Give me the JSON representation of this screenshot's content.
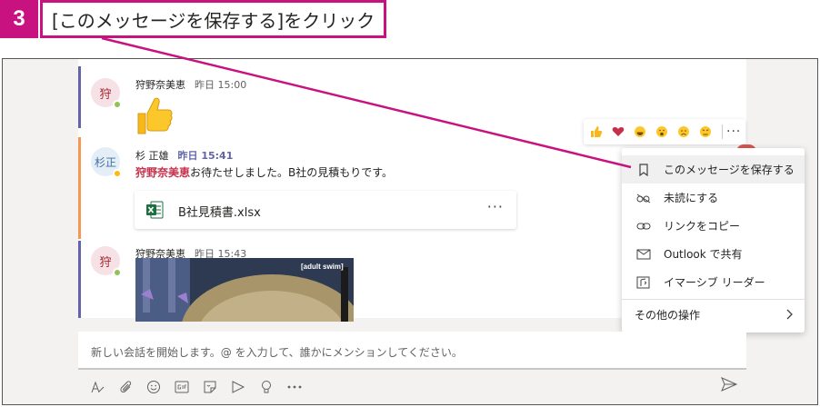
{
  "step": {
    "number": "3",
    "instruction": "[このメッセージを保存する]をクリック"
  },
  "messages": [
    {
      "avatar": "狩",
      "sender": "狩野奈美恵",
      "time": "昨日 15:00",
      "content_icon": "thumbs-up-emoji"
    },
    {
      "avatar": "杉正",
      "sender": "杉 正雄",
      "time": "昨日 15:41",
      "mention": "狩野奈美恵",
      "text": "お待たせしました。B社の見積もりです。",
      "attachment": {
        "filename": "B社見積書.xlsx",
        "file_icon": "excel-icon",
        "more": "···"
      }
    },
    {
      "avatar": "狩",
      "sender": "狩野奈美恵",
      "time": "昨日 15:43",
      "gif_caption": "[adult swim]"
    }
  ],
  "reactions": [
    "like",
    "heart",
    "laugh",
    "surprised",
    "sad",
    "angry"
  ],
  "reactions_more": "···",
  "context_menu": [
    {
      "label": "このメッセージを保存する",
      "icon": "bookmark-icon"
    },
    {
      "label": "未読にする",
      "icon": "unread-icon"
    },
    {
      "label": "リンクをコピー",
      "icon": "link-icon"
    },
    {
      "label": "Outlook で共有",
      "icon": "mail-icon"
    },
    {
      "label": "イマーシブ リーダー",
      "icon": "immersive-reader-icon"
    },
    {
      "label": "その他の操作",
      "icon": "chevron-right-icon"
    }
  ],
  "compose": {
    "placeholder": "新しい会話を開始します。@ を入力して、誰かにメンションしてください。"
  },
  "toolbar": [
    "format-icon",
    "attach-icon",
    "emoji-icon",
    "gif-icon",
    "sticker-icon",
    "meet-icon",
    "praise-icon",
    "more-icon",
    "send-icon"
  ],
  "colors": {
    "accent": "#c8127f",
    "teams_purple": "#6264a7",
    "mention": "#c4314b",
    "excel": "#1d6f42",
    "presence_green": "#92c353",
    "presence_away": "#fdb913"
  }
}
